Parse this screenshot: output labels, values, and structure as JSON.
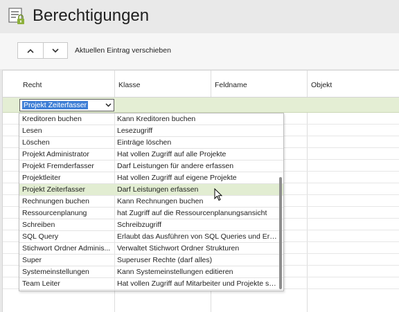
{
  "window": {
    "title": "Berechtigungen",
    "icon": "permissions-list-lock-icon"
  },
  "toolbar": {
    "up_icon": "chevron-up-icon",
    "down_icon": "chevron-down-icon",
    "move_label": "Aktuellen Eintrag verschieben"
  },
  "grid": {
    "columns": [
      "Recht",
      "Klasse",
      "Feldname",
      "Objekt"
    ],
    "edit_row": {
      "combo_value": "Projekt Zeiterfasser"
    }
  },
  "dropdown": {
    "items": [
      {
        "name": "Kreditoren buchen",
        "desc": "Kann Kreditoren buchen"
      },
      {
        "name": "Lesen",
        "desc": "Lesezugriff"
      },
      {
        "name": "Löschen",
        "desc": "Einträge löschen"
      },
      {
        "name": "Projekt Administrator",
        "desc": "Hat vollen Zugriff auf alle Projekte"
      },
      {
        "name": "Projekt Fremderfasser",
        "desc": "Darf Leistungen für andere erfassen"
      },
      {
        "name": "Projektleiter",
        "desc": "Hat vollen Zugriff auf eigene Projekte"
      },
      {
        "name": "Projekt Zeiterfasser",
        "desc": "Darf Leistungen erfassen",
        "selected": true
      },
      {
        "name": "Rechnungen buchen",
        "desc": "Kann Rechnungen buchen"
      },
      {
        "name": "Ressourcenplanung",
        "desc": "hat Zugriff auf die Ressourcenplanungsansicht"
      },
      {
        "name": "Schreiben",
        "desc": "Schreibzugriff"
      },
      {
        "name": "SQL Query",
        "desc": "Erlaubt das Ausführen von SQL Queries und Erstell..."
      },
      {
        "name": "Stichwort Ordner Adminis...",
        "desc": "Verwaltet Stichwort Ordner Strukturen"
      },
      {
        "name": "Super",
        "desc": "Superuser Rechte (darf alles)"
      },
      {
        "name": "Systemeinstellungen",
        "desc": "Kann Systemeinstellungen editieren"
      },
      {
        "name": "Team Leiter",
        "desc": "Hat vollen Zugriff auf Mitarbeiter und Projekte sei..."
      }
    ]
  }
}
